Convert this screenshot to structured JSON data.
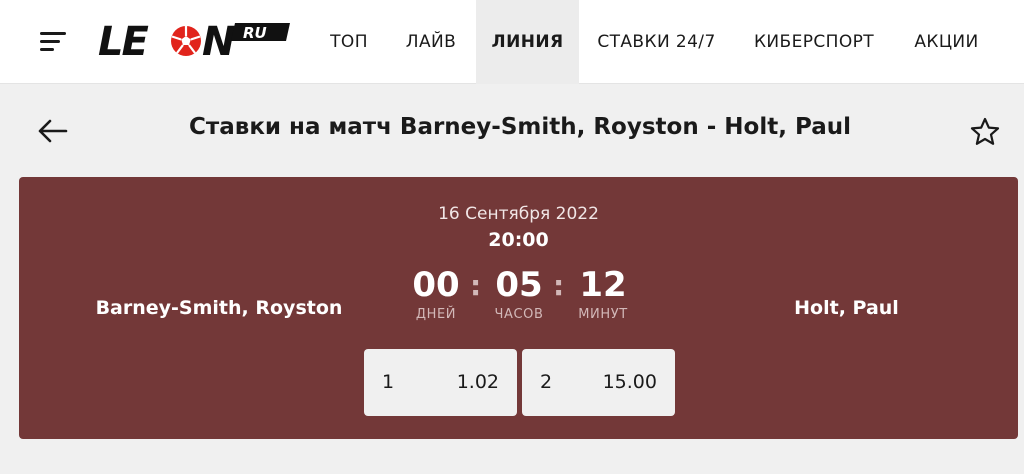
{
  "header": {
    "logo_text": "LEON",
    "logo_suffix": "RU",
    "nav": [
      {
        "label": "ТОП",
        "active": false
      },
      {
        "label": "ЛАЙВ",
        "active": false
      },
      {
        "label": "ЛИНИЯ",
        "active": true
      },
      {
        "label": "СТАВКИ 24/7",
        "active": false
      },
      {
        "label": "КИБЕРСПОРТ",
        "active": false
      },
      {
        "label": "АКЦИИ",
        "active": false
      }
    ]
  },
  "page": {
    "title": "Ставки на матч Barney-Smith, Royston - Holt, Paul"
  },
  "match": {
    "date": "16 Сентября 2022",
    "time": "20:00",
    "home_team": "Barney-Smith, Royston",
    "away_team": "Holt, Paul",
    "countdown": {
      "days": {
        "value": "00",
        "label": "ДНЕЙ"
      },
      "hours": {
        "value": "05",
        "label": "ЧАСОВ"
      },
      "minutes": {
        "value": "12",
        "label": "МИНУТ"
      },
      "separator": ":"
    },
    "odds": [
      {
        "name": "1",
        "value": "1.02"
      },
      {
        "name": "2",
        "value": "15.00"
      }
    ]
  },
  "colors": {
    "card_background": "#733838",
    "header_background": "#ffffff",
    "page_background": "#f0f0f0",
    "logo_ball_red": "#e1241c"
  },
  "icons": {
    "menu": "hamburger-menu-icon",
    "back": "arrow-left-icon",
    "favorite": "star-outline-icon",
    "logo_ball": "soccer-ball-icon"
  }
}
